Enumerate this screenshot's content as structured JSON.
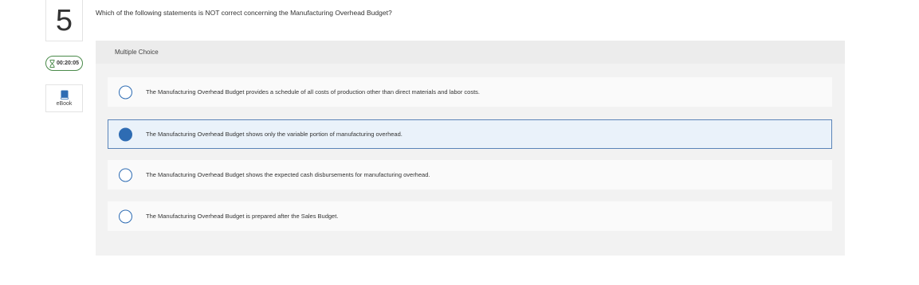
{
  "question": {
    "number": "5",
    "text": "Which of the following statements is NOT correct concerning the Manufacturing Overhead Budget?"
  },
  "timer": {
    "value": "00:20:05"
  },
  "ebook": {
    "label": "eBook"
  },
  "panel": {
    "header": "Multiple Choice"
  },
  "options": [
    {
      "text": "The Manufacturing Overhead Budget provides a schedule of all costs of production other than direct materials and labor costs.",
      "selected": false
    },
    {
      "text": "The Manufacturing Overhead Budget shows only the variable portion of manufacturing overhead.",
      "selected": true
    },
    {
      "text": "The Manufacturing Overhead Budget shows the expected cash disbursements for manufacturing overhead.",
      "selected": false
    },
    {
      "text": "The Manufacturing Overhead Budget is prepared after the Sales Budget.",
      "selected": false
    }
  ],
  "colors": {
    "accent": "#2e6cb3",
    "selected_bg": "#eaf2fa",
    "timer_border": "#4a8a4a"
  }
}
